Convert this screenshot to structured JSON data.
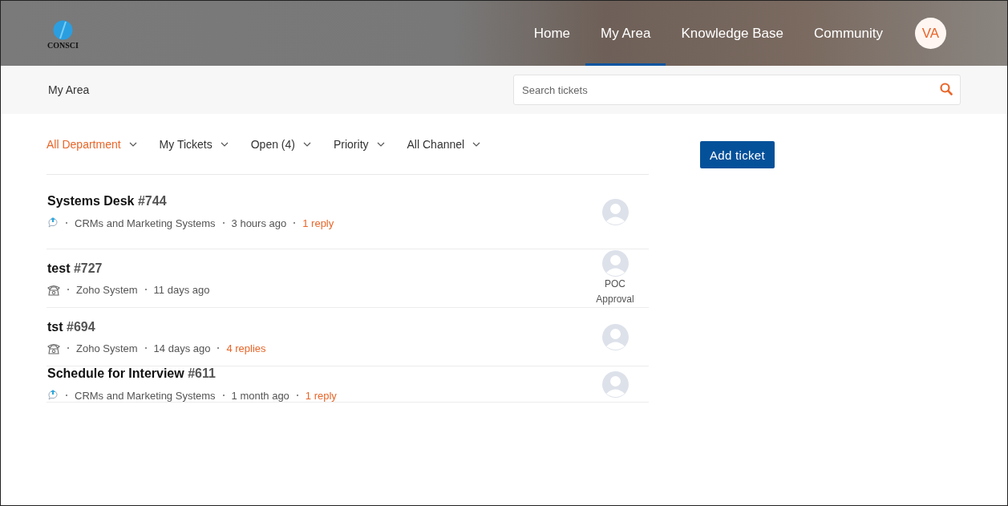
{
  "header": {
    "logo_text": "CONSCI",
    "nav": [
      {
        "label": "Home",
        "selected": false
      },
      {
        "label": "My Area",
        "selected": true
      },
      {
        "label": "Knowledge Base",
        "selected": false
      },
      {
        "label": "Community",
        "selected": false
      }
    ],
    "user_initials": "VA"
  },
  "subbar": {
    "breadcrumb": "My Area",
    "search": {
      "placeholder": "Search tickets"
    }
  },
  "filters": [
    {
      "label": "All Department",
      "selected": true
    },
    {
      "label": "My Tickets",
      "selected": false
    },
    {
      "label": "Open (4)",
      "selected": false
    },
    {
      "label": "Priority",
      "selected": false
    },
    {
      "label": "All Channel",
      "selected": false
    }
  ],
  "add_button": "Add ticket",
  "tickets": [
    {
      "title": "Systems Desk",
      "number": "#744",
      "kind": "web",
      "department": "CRMs and Marketing Systems",
      "time": "3 hours ago",
      "replies": "1 reply"
    },
    {
      "title": "test",
      "number": "#727",
      "kind": "phone",
      "department": "Zoho System",
      "time": "11 days ago",
      "status": "POC Approval"
    },
    {
      "title": "tst",
      "number": "#694",
      "kind": "phone",
      "department": "Zoho System",
      "time": "14 days ago",
      "replies": "4 replies"
    },
    {
      "title": "Schedule for Interview",
      "number": "#611",
      "kind": "web",
      "department": "CRMs and Marketing Systems",
      "time": "1 month ago",
      "replies": "1 reply"
    }
  ]
}
